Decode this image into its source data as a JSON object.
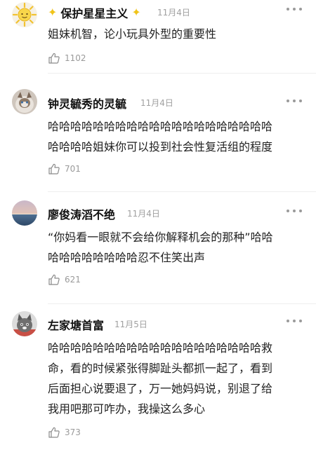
{
  "comments": [
    {
      "username": "保护星星主义",
      "date": "11月4日",
      "lines": [
        "姐妹机智，论小玩具外型的重要性"
      ],
      "likes": "1102",
      "avatar_icon": "sun-icon",
      "decorations": [
        "sparkle-icon",
        "sparkle-icon"
      ]
    },
    {
      "username": "钟灵毓秀的灵毓",
      "date": "11月4日",
      "lines": [
        "哈哈哈哈哈哈哈哈哈哈哈哈哈哈哈哈哈哈哈哈",
        "哈哈哈哈姐妹你可以投到社会性复活组的程度"
      ],
      "likes": "701",
      "avatar_icon": "cat-icon"
    },
    {
      "username": "廖俊涛滔不绝",
      "date": "11月4日",
      "lines": [
        "“你妈看一眼就不会给你解释机会的那种”哈哈",
        "哈哈哈哈哈哈哈哈忍不住笑出声"
      ],
      "likes": "621",
      "avatar_icon": "sunset-sea-icon"
    },
    {
      "username": "左家塘首富",
      "date": "11月5日",
      "lines": [
        "哈哈哈哈哈哈哈哈哈哈哈哈哈哈哈哈哈哈哈救",
        "命，看的时候紧张得脚趾头都抓一起了，看到",
        "后面担心说要退了，万一她妈妈说，别退了给",
        "我用吧那可咋办，我操这么多心"
      ],
      "likes": "373",
      "avatar_icon": "cat-photo-icon"
    }
  ]
}
